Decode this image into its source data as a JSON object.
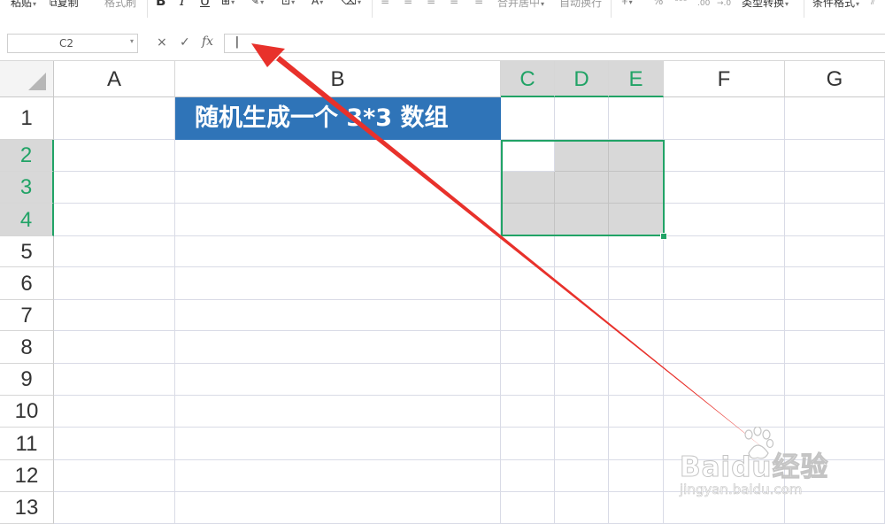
{
  "toolbar": {
    "paste": "粘贴",
    "copy": "复制",
    "format_painter": "格式刷",
    "bold": "B",
    "italic": "I",
    "underline": "U",
    "merge_center": "合并居中",
    "wrap_text": "自动换行",
    "percent": "%",
    "decimal_add": ".00",
    "decimal_remove": "→.0",
    "type_convert": "类型转换",
    "conditional_format": "条件格式"
  },
  "formula_bar": {
    "name_box": "C2",
    "cancel_icon": "×",
    "confirm_icon": "✓",
    "fx_label": "fx",
    "value": "|"
  },
  "columns": [
    "A",
    "B",
    "C",
    "D",
    "E",
    "F",
    "G"
  ],
  "rows": [
    "1",
    "2",
    "3",
    "4",
    "5",
    "6",
    "7",
    "8",
    "9",
    "10",
    "11",
    "12",
    "13"
  ],
  "selected_columns": [
    "C",
    "D",
    "E"
  ],
  "selected_rows": [
    "2",
    "3",
    "4"
  ],
  "cells": {
    "B1": "随机生成一个 3*3 数组"
  },
  "annotation": {
    "type": "red-arrow",
    "color": "#e8312b",
    "from": "lower right",
    "points_to": "formula-bar-input"
  },
  "watermark": {
    "brand": "Bai",
    "brand_suffix": "经验",
    "url": "jingyan.baidu.com"
  },
  "colors": {
    "title_bg": "#2f74b8",
    "title_text": "#ffffff",
    "selection": "#21a366",
    "selected_fill": "#d8d8d8"
  }
}
